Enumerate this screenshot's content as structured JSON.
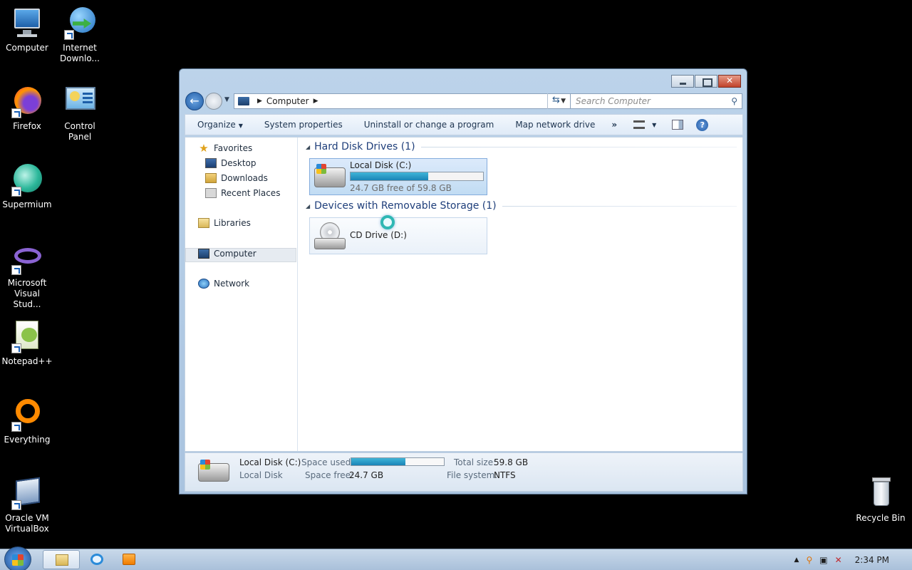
{
  "desktop": {
    "icons": [
      {
        "label": "Computer",
        "icon": "computer-icon"
      },
      {
        "label": "Internet Downlo...",
        "icon": "internet-download-manager-icon"
      },
      {
        "label": "Firefox",
        "icon": "firefox-icon"
      },
      {
        "label": "Control Panel",
        "icon": "control-panel-icon"
      },
      {
        "label": "Supermium",
        "icon": "supermium-icon"
      },
      {
        "label": "Microsoft Visual Stud...",
        "icon": "visual-studio-icon"
      },
      {
        "label": "Notepad++",
        "icon": "notepadpp-icon"
      },
      {
        "label": "Everything",
        "icon": "everything-icon"
      },
      {
        "label": "Oracle VM VirtualBox",
        "icon": "virtualbox-icon"
      },
      {
        "label": "Recycle Bin",
        "icon": "recycle-bin-icon"
      }
    ]
  },
  "window": {
    "address": {
      "crumb": "Computer"
    },
    "search": {
      "placeholder": "Search Computer"
    },
    "toolbar": {
      "organize": "Organize",
      "system_properties": "System properties",
      "uninstall": "Uninstall or change a program",
      "map_drive": "Map network drive",
      "more": "»"
    },
    "navpane": {
      "favorites": "Favorites",
      "desktop": "Desktop",
      "downloads": "Downloads",
      "recent": "Recent Places",
      "libraries": "Libraries",
      "computer": "Computer",
      "network": "Network"
    },
    "groups": {
      "hdd": {
        "title": "Hard Disk Drives (1)",
        "drive_name": "Local Disk (C:)",
        "free_text": "24.7 GB free of 59.8 GB",
        "used_fraction": 0.587
      },
      "removable": {
        "title": "Devices with Removable Storage (1)",
        "drive_name": "CD Drive (D:)"
      }
    },
    "details": {
      "name": "Local Disk (C:)",
      "type": "Local Disk",
      "space_used_label": "Space used:",
      "space_free_label": "Space free:",
      "space_free_value": "24.7 GB",
      "total_size_label": "Total size:",
      "total_size_value": "59.8 GB",
      "file_system_label": "File system:",
      "file_system_value": "NTFS",
      "used_fraction": 0.587
    }
  },
  "taskbar": {
    "clock": "2:34 PM",
    "show_hidden": "▲"
  },
  "colors": {
    "desktop_bg": "#000000",
    "progress": "#1a84b6",
    "group_title": "#1e3e7a"
  }
}
